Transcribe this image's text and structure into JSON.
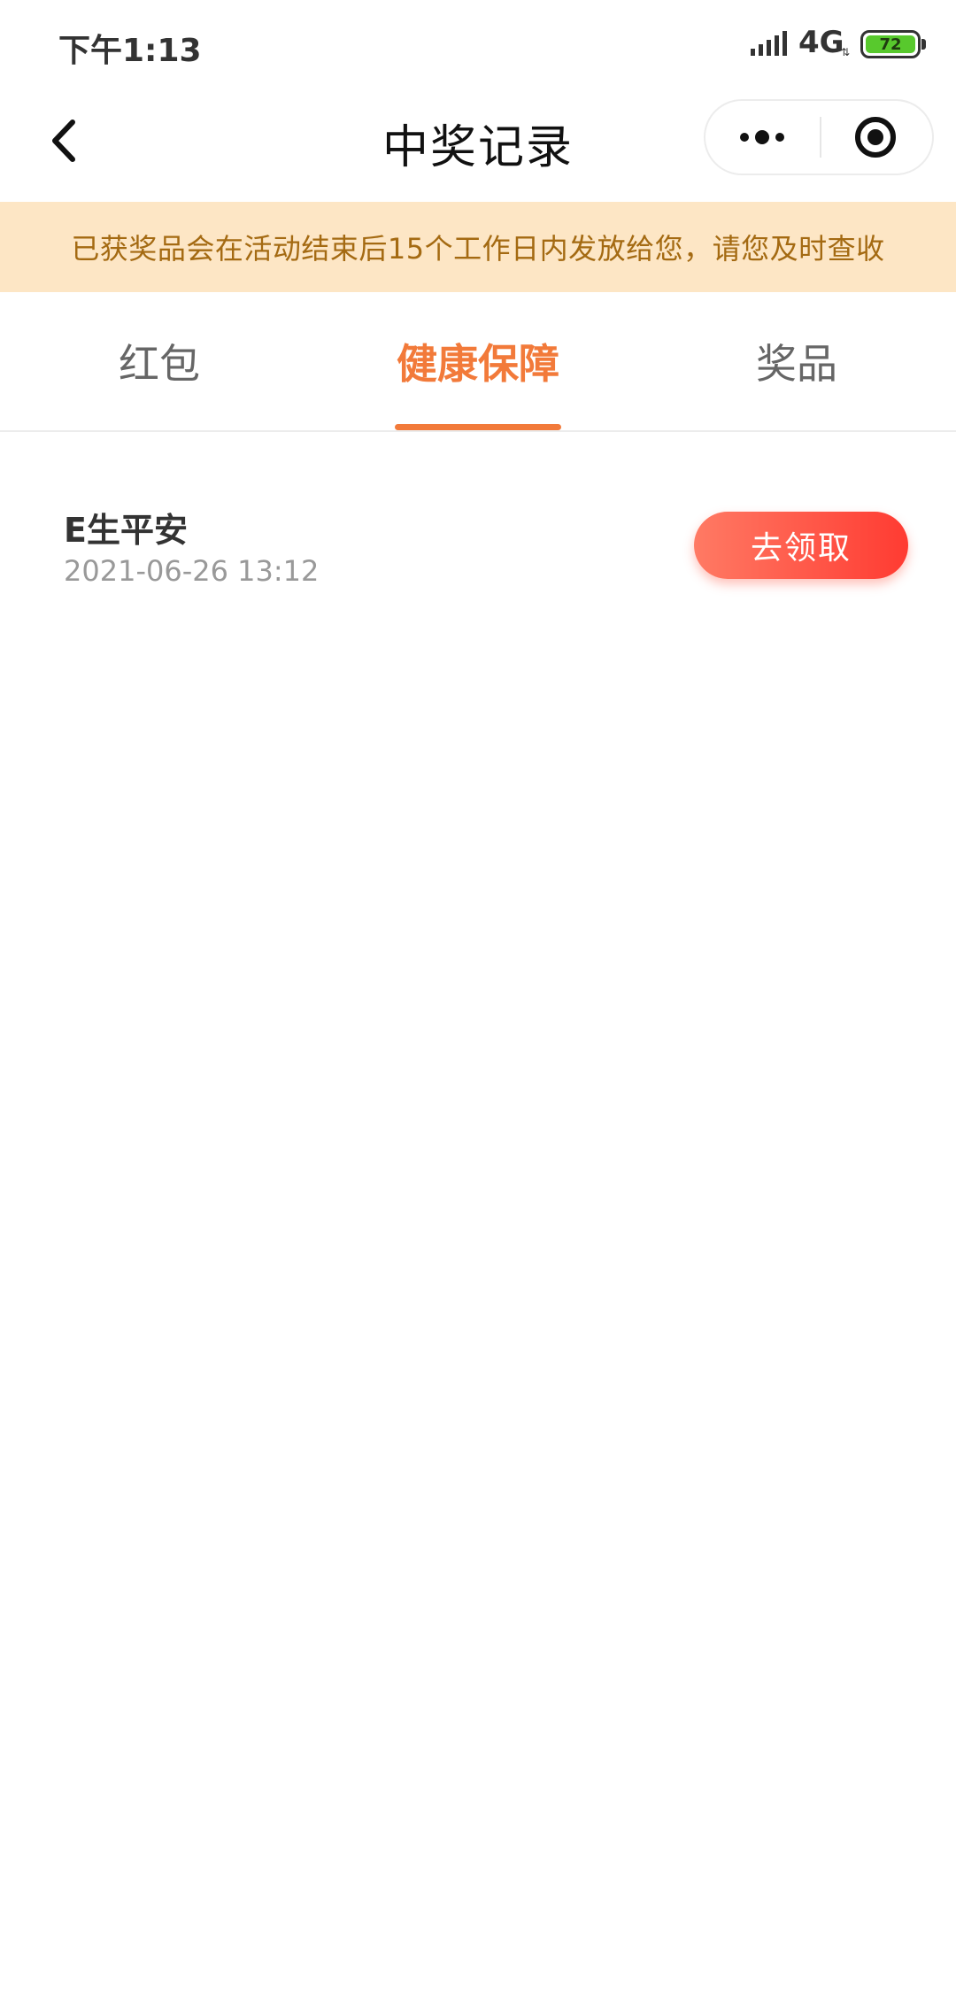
{
  "status_bar": {
    "time": "下午1:13",
    "network": "4G",
    "battery": "72"
  },
  "nav": {
    "title": "中奖记录"
  },
  "notice": {
    "text": "已获奖品会在活动结束后15个工作日内发放给您，请您及时查收"
  },
  "tabs": [
    {
      "label": "红包",
      "active": false
    },
    {
      "label": "健康保障",
      "active": true
    },
    {
      "label": "奖品",
      "active": false
    }
  ],
  "records": [
    {
      "name": "E生平安",
      "time": "2021-06-26 13:12",
      "action": "去领取"
    }
  ],
  "colors": {
    "accent": "#f27a3a",
    "notice_bg": "#fde6c5",
    "notice_text": "#a46a12",
    "button_start": "#ff7a64",
    "button_end": "#ff3b32"
  },
  "icons": [
    "signal-icon",
    "battery-icon",
    "back-arrow-icon",
    "more-dots-icon",
    "close-target-icon"
  ]
}
